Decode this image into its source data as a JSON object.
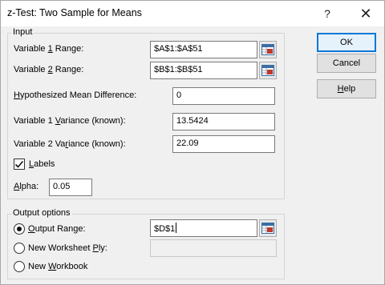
{
  "window": {
    "title": "z-Test: Two Sample for Means",
    "help_glyph": "?",
    "close_glyph": "✕"
  },
  "input_group": {
    "legend": "Input",
    "var1_range": {
      "label_pre": "Variable ",
      "label_ul": "1",
      "label_post": " Range:",
      "value": "$A$1:$A$51"
    },
    "var2_range": {
      "label_pre": "Variable ",
      "label_ul": "2",
      "label_post": " Range:",
      "value": "$B$1:$B$51"
    },
    "hyp_mean_diff": {
      "label_pre": "",
      "label_ul": "H",
      "label_post": "ypothesized Mean Difference:",
      "value": "0"
    },
    "var1_variance": {
      "label_pre": "Variable 1 ",
      "label_ul": "V",
      "label_post": "ariance (known):",
      "value": "13.5424"
    },
    "var2_variance": {
      "label_pre": "Variable 2 Va",
      "label_ul": "r",
      "label_post": "iance (known):",
      "value": "22.09"
    },
    "labels": {
      "label_pre": "",
      "label_ul": "L",
      "label_post": "abels",
      "checked": true
    },
    "alpha": {
      "label_pre": "",
      "label_ul": "A",
      "label_post": "lpha:",
      "value": "0.05"
    }
  },
  "output_group": {
    "legend": "Output options",
    "output_range": {
      "label_pre": "",
      "label_ul": "O",
      "label_post": "utput Range:",
      "value": "$D$1",
      "selected": true
    },
    "new_worksheet": {
      "label_pre": "New Worksheet ",
      "label_ul": "P",
      "label_post": "ly:",
      "value": "",
      "selected": false
    },
    "new_workbook": {
      "label_pre": "New ",
      "label_ul": "W",
      "label_post": "orkbook",
      "selected": false
    }
  },
  "buttons": {
    "ok": "OK",
    "cancel": "Cancel",
    "help_pre": "",
    "help_ul": "H",
    "help_post": "elp"
  },
  "icons": {
    "collapse": "range-collapse-icon",
    "check": "checkmark-icon",
    "accent": "#0078d7"
  }
}
